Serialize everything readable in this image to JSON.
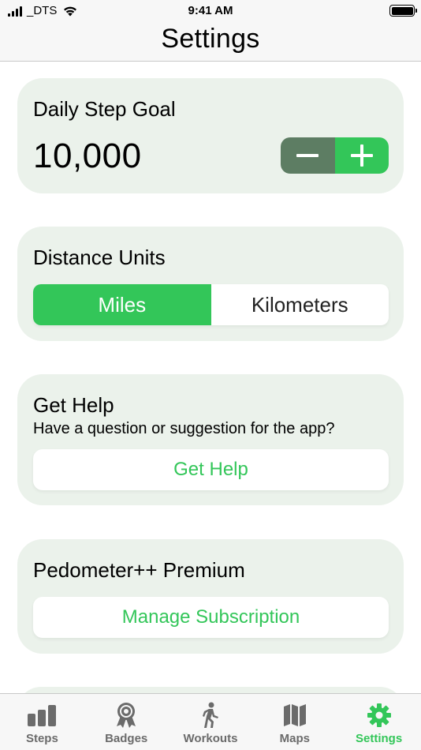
{
  "status_bar": {
    "carrier": "_DTS",
    "time": "9:41 AM"
  },
  "nav": {
    "title": "Settings"
  },
  "step_goal": {
    "title": "Daily Step Goal",
    "value": "10,000"
  },
  "distance_units": {
    "title": "Distance Units",
    "options": [
      "Miles",
      "Kilometers"
    ],
    "selected": "Miles"
  },
  "get_help": {
    "title": "Get Help",
    "subtitle": "Have a question or suggestion for the app?",
    "button_label": "Get Help"
  },
  "premium": {
    "title": "Pedometer++ Premium",
    "button_label": "Manage Subscription"
  },
  "tabs": [
    {
      "label": "Steps",
      "icon": "bar-chart-icon",
      "active": false
    },
    {
      "label": "Badges",
      "icon": "badge-ribbon-icon",
      "active": false
    },
    {
      "label": "Workouts",
      "icon": "walking-person-icon",
      "active": false
    },
    {
      "label": "Maps",
      "icon": "map-icon",
      "active": false
    },
    {
      "label": "Settings",
      "icon": "gear-icon",
      "active": true
    }
  ],
  "colors": {
    "accent": "#33c659",
    "stepper_minus": "#5d7d63",
    "card_background": "#ebf2eb",
    "tab_inactive": "#6b6b6b"
  }
}
